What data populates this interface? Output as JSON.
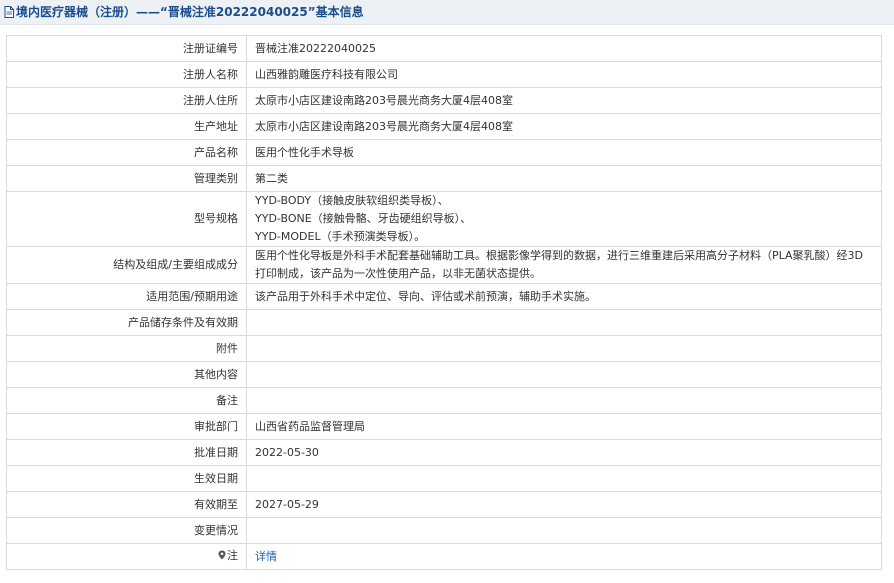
{
  "header": {
    "title": "境内医疗器械（注册）——“晋械注准20222040025”基本信息"
  },
  "rows": [
    {
      "label": "注册证编号",
      "value": "晋械注准20222040025"
    },
    {
      "label": "注册人名称",
      "value": "山西雅韵雕医疗科技有限公司"
    },
    {
      "label": "注册人住所",
      "value": "太原市小店区建设南路203号晨光商务大厦4层408室"
    },
    {
      "label": "生产地址",
      "value": "太原市小店区建设南路203号晨光商务大厦4层408室"
    },
    {
      "label": "产品名称",
      "value": "医用个性化手术导板"
    },
    {
      "label": "管理类别",
      "value": "第二类"
    },
    {
      "label": "型号规格",
      "lines": [
        "YYD-BODY（接触皮肤软组织类导板）、",
        "YYD-BONE（接触骨骼、牙齿硬组织导板）、",
        "YYD-MODEL（手术预演类导板）。"
      ]
    },
    {
      "label": "结构及组成/主要组成成分",
      "value": "医用个性化导板是外科手术配套基础辅助工具。根据影像学得到的数据，进行三维重建后采用高分子材料（PLA聚乳酸）经3D打印制成，该产品为一次性使用产品，以非无菌状态提供。"
    },
    {
      "label": "适用范围/预期用途",
      "value": "该产品用于外科手术中定位、导向、评估或术前预演，辅助手术实施。"
    },
    {
      "label": "产品储存条件及有效期",
      "value": ""
    },
    {
      "label": "附件",
      "value": ""
    },
    {
      "label": "其他内容",
      "value": ""
    },
    {
      "label": "备注",
      "value": ""
    },
    {
      "label": "审批部门",
      "value": "山西省药品监督管理局"
    },
    {
      "label": "批准日期",
      "value": "2022-05-30"
    },
    {
      "label": "生效日期",
      "value": ""
    },
    {
      "label": "有效期至",
      "value": "2027-05-29"
    },
    {
      "label": "变更情况",
      "value": ""
    },
    {
      "label": "注",
      "value": "详情"
    }
  ],
  "icons": {
    "header_icon": "document-icon",
    "note_icon": "pin-icon"
  }
}
